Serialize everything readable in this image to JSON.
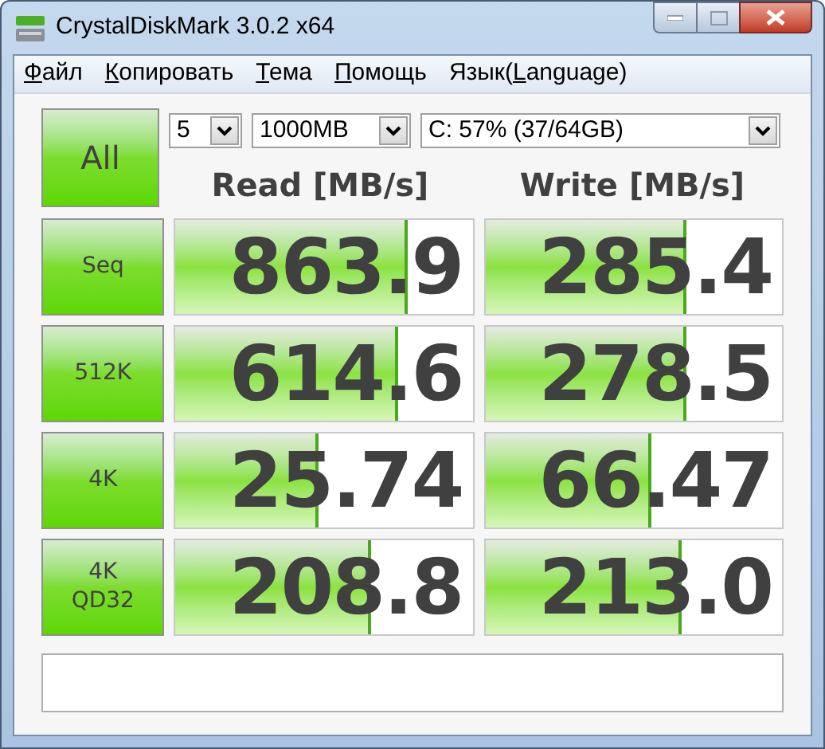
{
  "window": {
    "title": "CrystalDiskMark 3.0.2 x64"
  },
  "menu": [
    {
      "key": "Ф",
      "after": "айл"
    },
    {
      "key": "К",
      "after": "опировать"
    },
    {
      "key": "Т",
      "after": "ема"
    },
    {
      "key": "П",
      "after": "омощь"
    },
    {
      "before": "Язык(",
      "key": "L",
      "after": "anguage)"
    }
  ],
  "all_button": {
    "label": "All"
  },
  "selectors": {
    "count": "5",
    "size": "1000MB",
    "drive": "C: 57% (37/64GB)"
  },
  "columns": [
    "Read [MB/s]",
    "Write [MB/s]"
  ],
  "rows": [
    {
      "label": "Seq",
      "read": {
        "value": "863.9",
        "level": 0.78
      },
      "write": {
        "value": "285.4",
        "level": 0.68
      }
    },
    {
      "label": "512K",
      "read": {
        "value": "614.6",
        "level": 0.75
      },
      "write": {
        "value": "278.5",
        "level": 0.68
      }
    },
    {
      "label": "4K",
      "read": {
        "value": "25.74",
        "level": 0.48
      },
      "write": {
        "value": "66.47",
        "level": 0.56
      }
    },
    {
      "label": "4K\nQD32",
      "read": {
        "value": "208.8",
        "level": 0.66
      },
      "write": {
        "value": "213.0",
        "level": 0.66
      }
    }
  ]
}
